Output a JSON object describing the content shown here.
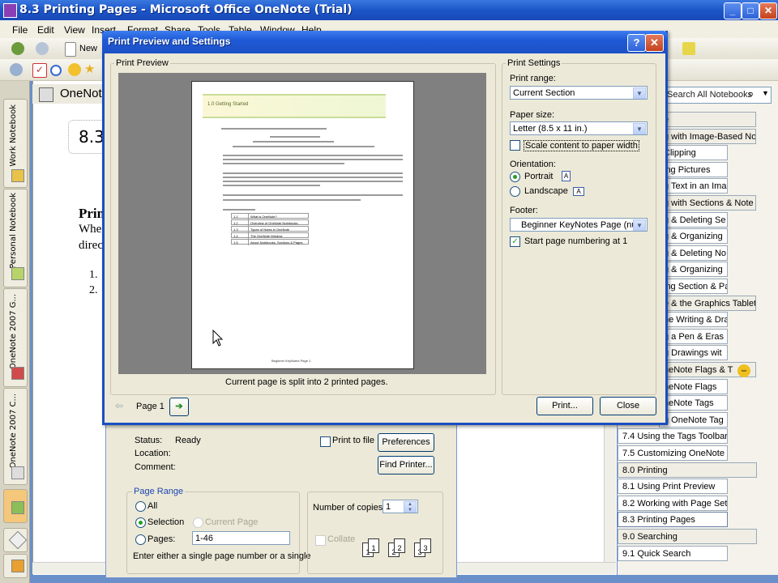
{
  "window": {
    "title": "8.3 Printing Pages - Microsoft Office OneNote (Trial)",
    "minimize": "_",
    "maximize": "□",
    "close": "✕"
  },
  "menus": [
    "File",
    "Edit",
    "View",
    "Insert",
    "Format",
    "Share",
    "Tools",
    "Table",
    "Window",
    "Help"
  ],
  "toolbar": {
    "new_label": "New"
  },
  "search": {
    "placeholder": "Search All Notebooks"
  },
  "notebook_header": "OneNote",
  "page_bg": {
    "title": "8.3",
    "heading": "Prin",
    "line1": "Whe",
    "line2": "direc",
    "item1": "1.",
    "item2": "2."
  },
  "left_tabs": [
    "Work Notebook",
    "Personal Notebook",
    "OneNote 2007 G...",
    "OneNote 2007 C..."
  ],
  "right_pages": [
    {
      "label": "e",
      "type": "section"
    },
    {
      "label": "g with Image-Based Not",
      "type": "section"
    },
    {
      "label": "Clipping"
    },
    {
      "label": "ing Pictures"
    },
    {
      "label": "g Text in an Ima"
    },
    {
      "label": "g with Sections & Note",
      "type": "section"
    },
    {
      "label": "g & Deleting Se"
    },
    {
      "label": "g & Organizing"
    },
    {
      "label": "g & Deleting No"
    },
    {
      "label": "g & Organizing"
    },
    {
      "label": "ing Section & Pa"
    },
    {
      "label": "e & the Graphics Tablet",
      "type": "section"
    },
    {
      "label": "he Writing & Dra"
    },
    {
      "label": "g a Pen & Eras"
    },
    {
      "label": "g Drawings wit"
    },
    {
      "label": "neNote Flags & T",
      "type": "section"
    },
    {
      "label": "neNote Flags"
    },
    {
      "label": "neNote Tags"
    },
    {
      "label": "g OneNote Tag"
    },
    {
      "label": "7.4 Using the Tags Toolbar"
    },
    {
      "label": "7.5 Customizing OneNote T"
    },
    {
      "label": "8.0 Printing",
      "type": "section"
    },
    {
      "label": "8.1 Using Print Preview"
    },
    {
      "label": "8.2 Working with Page Set"
    },
    {
      "label": "8.3 Printing Pages",
      "type": "selected"
    },
    {
      "label": "9.0 Searching",
      "type": "section"
    },
    {
      "label": "9.1 Quick Search"
    }
  ],
  "dialog": {
    "title": "Print Preview and Settings",
    "help": "?",
    "close": "✕",
    "preview_group": "Print Preview",
    "settings_group": "Print Settings",
    "print_range_label": "Print range:",
    "print_range_value": "Current Section",
    "paper_size_label": "Paper size:",
    "paper_size_value": "Letter (8.5 x 11 in.)",
    "scale_label": "Scale content to paper width",
    "scale_checked": false,
    "orientation_label": "Orientation:",
    "portrait_label": "Portrait",
    "landscape_label": "Landscape",
    "orientation_selected": "portrait",
    "footer_label": "Footer:",
    "footer_value": "Beginner KeyNotes Page (numl",
    "start_numbering_label": "Start page numbering at 1",
    "start_numbering_checked": true,
    "split_note": "Current page is split into 2 printed pages.",
    "page_label": "Page 1",
    "print_button": "Print...",
    "close_button": "Close",
    "paper": {
      "heading": "1.0 Getting Started",
      "footer": "Beginner KeyNotes Page 1",
      "table_rows": [
        "What is OneNote?",
        "Overview of OneNote Notebooks",
        "Types of Notes in OneNote",
        "The OneNote Window",
        "About Notebooks, Sections & Pages"
      ],
      "table_nums": [
        "1.1",
        "1.2",
        "1.3",
        "1.4",
        "1.5"
      ]
    }
  },
  "print_dialog": {
    "status_label": "Status:",
    "status_value": "Ready",
    "location_label": "Location:",
    "comment_label": "Comment:",
    "print_to_file": "Print to file",
    "preferences": "Preferences",
    "find_printer": "Find Printer...",
    "page_range": "Page Range",
    "all": "All",
    "selection": "Selection",
    "current_page": "Current Page",
    "pages": "Pages:",
    "pages_value": "1-46",
    "hint": "Enter either a single page number or a single",
    "copies_label": "Number of copies:",
    "copies_value": "1",
    "collate": "Collate",
    "collate_nums": [
      "1",
      "1",
      "2",
      "2",
      "3",
      "3"
    ]
  }
}
